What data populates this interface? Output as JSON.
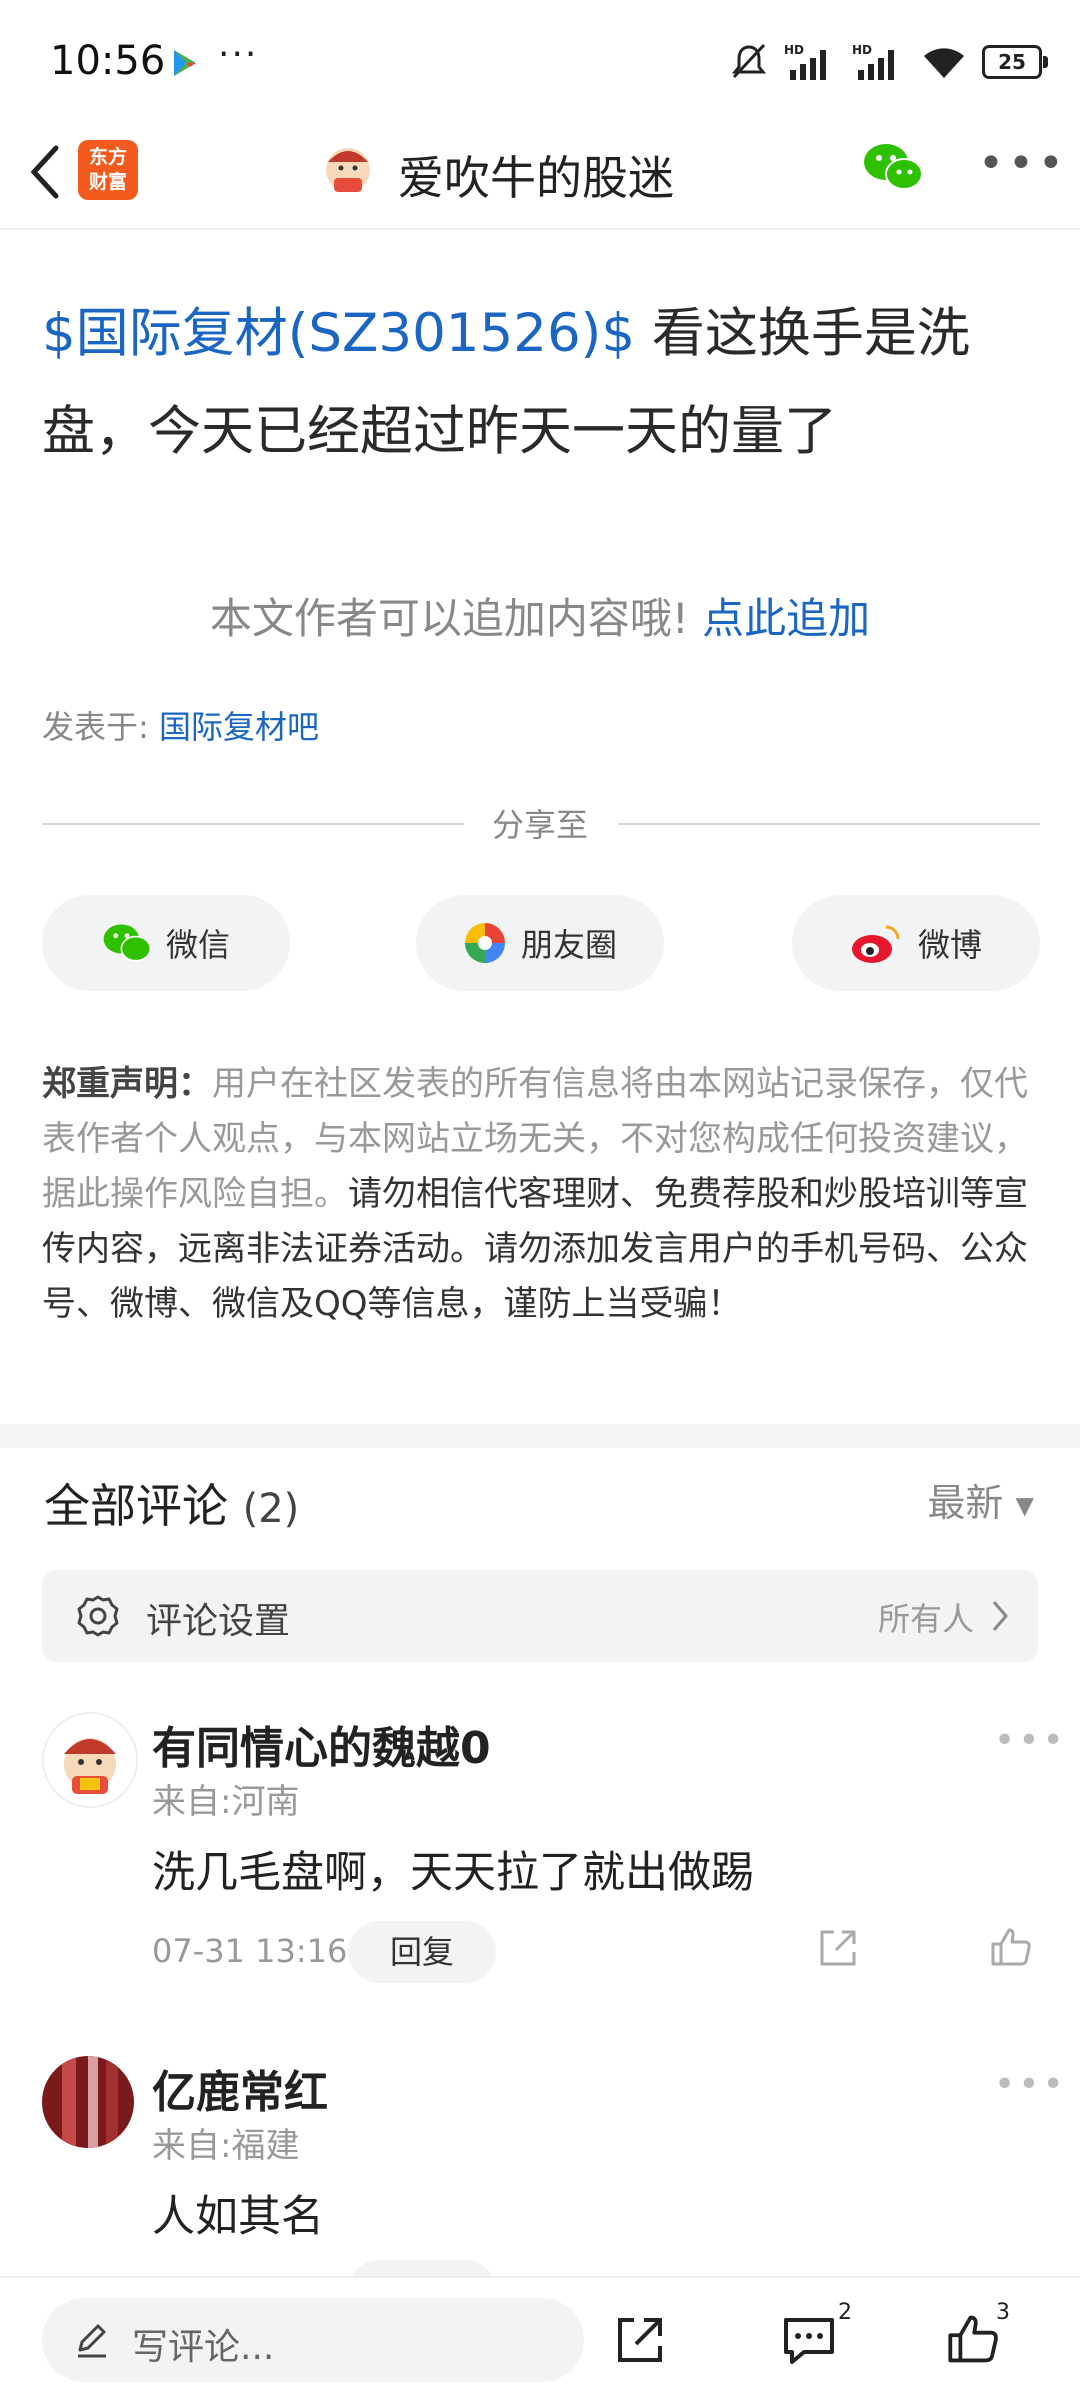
{
  "status_bar": {
    "time": "10:56",
    "dots": "···",
    "battery": "25"
  },
  "header": {
    "logo_line1": "东方",
    "logo_line2": "财富",
    "title": "爱吹牛的股迷"
  },
  "post": {
    "stock_tag": "$国际复材(SZ301526)$",
    "text": " 看这换手是洗盘，今天已经超过昨天一天的量了",
    "append_prompt": "本文作者可以追加内容哦!",
    "append_link": "点此追加",
    "posted_in_label": "发表于:",
    "posted_in_value": "国际复材吧"
  },
  "share": {
    "label": "分享至",
    "wechat": "微信",
    "moments": "朋友圈",
    "weibo": "微博"
  },
  "disclaimer": {
    "title": "郑重声明：",
    "body": "用户在社区发表的所有信息将由本网站记录保存，仅代表作者个人观点，与本网站立场无关，不对您构成任何投资建议，据此操作风险自担。",
    "warning": "请勿相信代客理财、免费荐股和炒股培训等宣传内容，远离非法证券活动。请勿添加发言用户的手机号码、公众号、微博、微信及QQ等信息，谨防上当受骗！"
  },
  "comments": {
    "title": "全部评论",
    "count": "(2)",
    "sort": "最新",
    "settings_label": "评论设置",
    "settings_value": "所有人",
    "items": [
      {
        "name": "有同情心的魏越0",
        "location": "来自:河南",
        "text": "洗几毛盘啊，天天拉了就出做踢",
        "time": "07-31 13:16",
        "reply": "回复"
      },
      {
        "name": "亿鹿常红",
        "location": "来自:福建",
        "text": "人如其名"
      }
    ]
  },
  "bottom_bar": {
    "placeholder": "写评论...",
    "comment_count": "2",
    "like_count": "3"
  },
  "colors": {
    "link_blue": "#1a66c2",
    "brand_orange": "#f25a1e",
    "wechat_green": "#2dc100"
  }
}
